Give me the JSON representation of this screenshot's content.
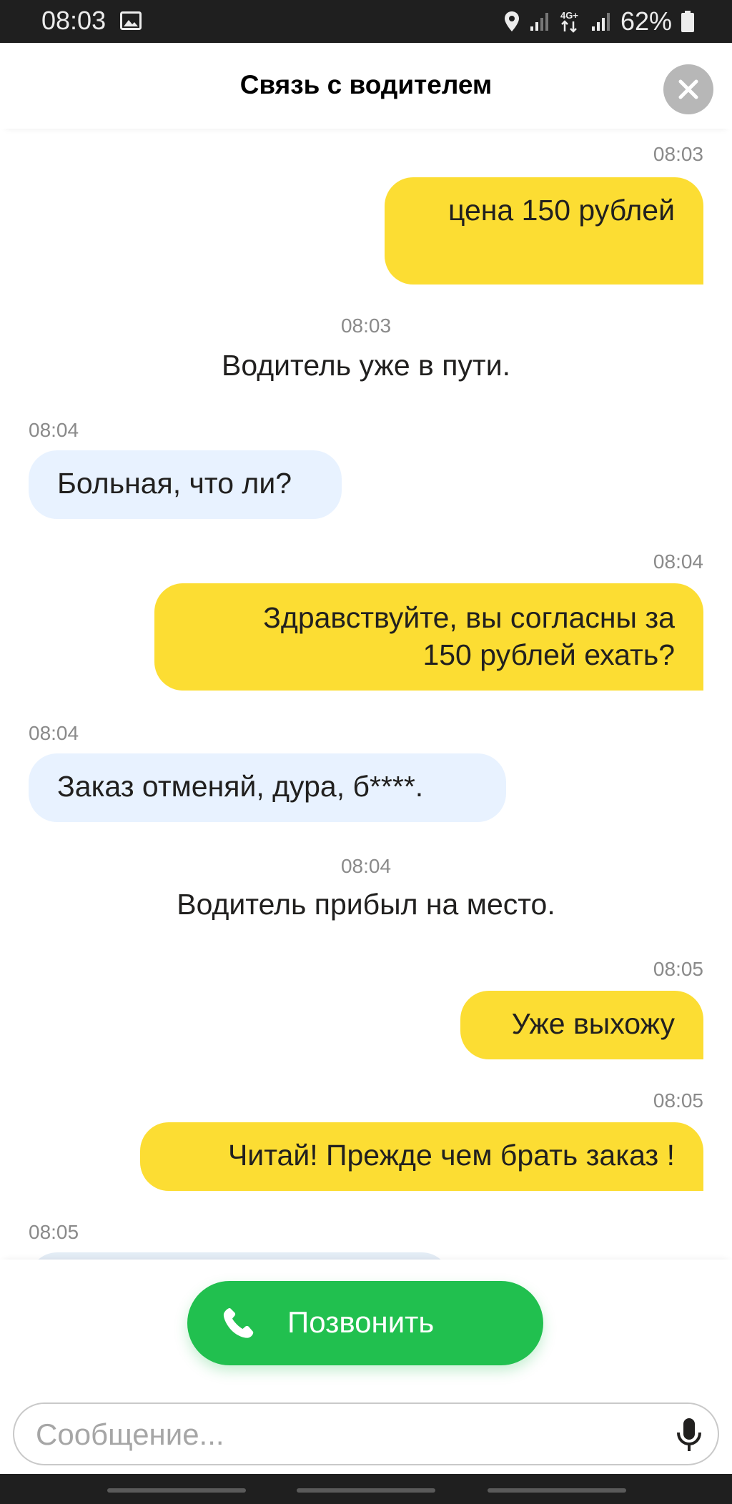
{
  "status_bar": {
    "time": "08:03",
    "battery": "62%",
    "network": "4G+"
  },
  "header": {
    "title": "Связь с водителем",
    "close_icon": "close-icon"
  },
  "messages": [
    {
      "type": "out",
      "time": "08:03",
      "text": "цена 150 рублей"
    },
    {
      "type": "system",
      "time": "08:03",
      "text": "Водитель уже в пути."
    },
    {
      "type": "in",
      "time": "08:04",
      "text": "Больная, что ли?"
    },
    {
      "type": "out",
      "time": "08:04",
      "text_line1": "Здравствуйте, вы согласны за",
      "text_line2": "150 рублей ехать?"
    },
    {
      "type": "in",
      "time": "08:04",
      "text": "Заказ отменяй, дура, б****."
    },
    {
      "type": "system",
      "time": "08:04",
      "text": "Водитель прибыл на место."
    },
    {
      "type": "out",
      "time": "08:05",
      "text": "Уже выхожу"
    },
    {
      "type": "out",
      "time": "08:05",
      "text": "Читай! Прежде чем брать заказ !"
    },
    {
      "type": "in",
      "time": "08:05",
      "text": ""
    }
  ],
  "call_button": {
    "label": "Позвонить",
    "icon": "phone-icon",
    "color": "#21c04f"
  },
  "message_input": {
    "placeholder": "Сообщение...",
    "value": "",
    "icon": "microphone-icon"
  },
  "colors": {
    "outgoing_bubble": "#fcdd33",
    "incoming_bubble": "#e8f2ff"
  }
}
